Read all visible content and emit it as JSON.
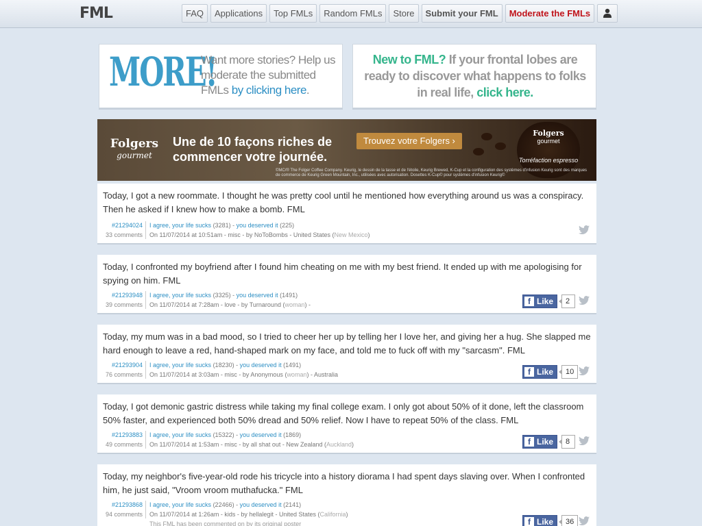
{
  "header": {
    "logo": "FML",
    "nav": [
      {
        "label": "FAQ",
        "style": "normal"
      },
      {
        "label": "Applications",
        "style": "normal"
      },
      {
        "label": "Top FMLs",
        "style": "normal"
      },
      {
        "label": "Random FMLs",
        "style": "normal"
      },
      {
        "label": "Store",
        "style": "normal"
      },
      {
        "label": "Submit your FML",
        "style": "bold"
      },
      {
        "label": "Moderate the FMLs",
        "style": "red"
      }
    ],
    "user_icon": "user-icon"
  },
  "promo_left": {
    "big_word": "MORE!",
    "text": "Want more stories? Help us moderate the submitted FMLs",
    "link": "by clicking here",
    "after": "."
  },
  "promo_right": {
    "lead": "New to FML?",
    "text": "If your frontal lobes are ready to discover what happens to folks in real life,",
    "link": "click here."
  },
  "ad": {
    "brand": "Folgers",
    "brand_sub": "gourmet",
    "headline": "Une de 10 façons riches de commencer votre journée.",
    "cta": "Trouvez votre Folgers ›",
    "fine_print": "©MC/® The Folger Coffee Company. Keurig, le dessin de la tasse et de l'étoile, Keurig Brewed, K-Cup et la configuration des systèmes d'infusion Keurig sont des marques de commerce de Keurig Green Mountain, Inc., utilisées avec autorisation. Dosettes K-Cup© pour systèmes d'infusion Keurig©",
    "cup_brand": "Folgers",
    "cup_sub": "gourmet",
    "cup_tag": "Torréfaction espresso"
  },
  "stories": [
    {
      "text": "Today, I got a new roommate. I thought he was pretty cool until he mentioned how everything around us was a conspiracy. Then he asked if I knew how to make a bomb. FML",
      "id": "#21294024",
      "comments": "33 comments",
      "agree": "I agree, your life sucks",
      "agree_count": "(3281)",
      "sep": " - ",
      "deserved": "you deserved it",
      "deserved_count": "(225)",
      "meta": "On 11/07/2014 at 10:51am - misc - by NoToBombs - United States (",
      "loc": "New Mexico",
      "meta_end": ")",
      "likes": ""
    },
    {
      "text": "Today, I confronted my boyfriend after I found him cheating on me with my best friend. It ended up with me apologising for spying on him. FML",
      "id": "#21293948",
      "comments": "39 comments",
      "agree": "I agree, your life sucks",
      "agree_count": "(3325)",
      "sep": " - ",
      "deserved": "you deserved it",
      "deserved_count": "(1491)",
      "meta": "On 11/07/2014 at 7:28am - love - by Turnaround (",
      "loc": "woman",
      "meta_end": ") -",
      "likes": "2"
    },
    {
      "text": "Today, my mum was in a bad mood, so I tried to cheer her up by telling her I love her, and giving her a hug. She slapped me hard enough to leave a red, hand-shaped mark on my face, and told me to fuck off with my \"sarcasm\". FML",
      "id": "#21293904",
      "comments": "76 comments",
      "agree": "I agree, your life sucks",
      "agree_count": "(18230)",
      "sep": " - ",
      "deserved": "you deserved it",
      "deserved_count": "(1491)",
      "meta": "On 11/07/2014 at 3:03am - misc - by Anonymous (",
      "loc": "woman",
      "meta_end": ") - Australia",
      "likes": "10"
    },
    {
      "text": "Today, I got demonic gastric distress while taking my final college exam. I only got about 50% of it done, left the classroom 50% faster, and experienced both 50% dread and 50% relief. Now I have to repeat 50% of the class. FML",
      "id": "#21293883",
      "comments": "49 comments",
      "agree": "I agree, your life sucks",
      "agree_count": "(15322)",
      "sep": " - ",
      "deserved": "you deserved it",
      "deserved_count": "(1869)",
      "meta": "On 11/07/2014 at 1:53am - misc - by all shat out - New Zealand (",
      "loc": "Auckland",
      "meta_end": ")",
      "likes": "8"
    },
    {
      "text": "Today, my neighbor's five-year-old rode his tricycle into a history diorama I had spent days slaving over. When I confronted him, he just said, \"Vroom vroom muthafucka.\" FML",
      "id": "#21293868",
      "comments": "94 comments",
      "agree": "I agree, your life sucks",
      "agree_count": "(22466)",
      "sep": " - ",
      "deserved": "you deserved it",
      "deserved_count": "(2141)",
      "meta": "On 11/07/2014 at 1:26am - kids - by hellalegit - United States (",
      "loc": "California",
      "meta_end": ")",
      "likes": "36",
      "owner_note": "This FML has been commented on by its original poster"
    }
  ],
  "fb_label": "Like",
  "icons": {
    "facebook": "facebook-icon",
    "twitter": "twitter-icon"
  },
  "colors": {
    "link": "#2d8fc4",
    "moderate": "#c0141b",
    "new_fml": "#35b58c",
    "facebook": "#4a66a0"
  }
}
